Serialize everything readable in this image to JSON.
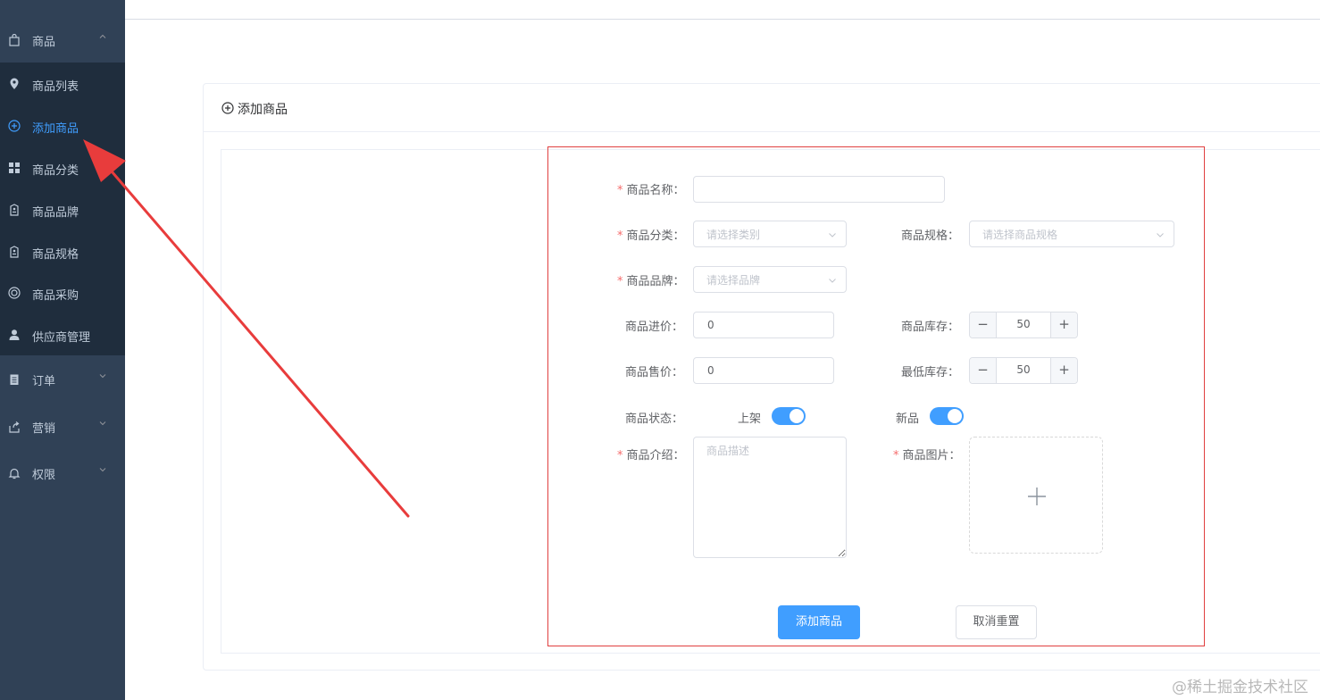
{
  "sidebar": {
    "groups": [
      {
        "label": "商品",
        "icon": "bag-icon",
        "expanded": true
      },
      {
        "label": "订单",
        "icon": "clipboard-icon",
        "expanded": false
      },
      {
        "label": "营销",
        "icon": "share-icon",
        "expanded": false
      },
      {
        "label": "权限",
        "icon": "bell-icon",
        "expanded": false
      }
    ],
    "items": [
      {
        "label": "商品列表",
        "icon": "location-pin-icon"
      },
      {
        "label": "添加商品",
        "icon": "circle-plus-icon",
        "active": true
      },
      {
        "label": "商品分类",
        "icon": "grid-icon"
      },
      {
        "label": "商品品牌",
        "icon": "tag-icon"
      },
      {
        "label": "商品规格",
        "icon": "tag-icon"
      },
      {
        "label": "商品采购",
        "icon": "target-icon"
      },
      {
        "label": "供应商管理",
        "icon": "user-icon"
      }
    ]
  },
  "card": {
    "title": "添加商品",
    "icon": "circle-plus-icon"
  },
  "form": {
    "name": {
      "label": "商品名称：",
      "required": true,
      "value": "",
      "placeholder": ""
    },
    "category": {
      "label": "商品分类：",
      "required": true,
      "placeholder": "请选择类别"
    },
    "spec": {
      "label": "商品规格：",
      "required": false,
      "placeholder": "请选择商品规格"
    },
    "brand": {
      "label": "商品品牌：",
      "required": true,
      "placeholder": "请选择品牌"
    },
    "cost_price": {
      "label": "商品进价：",
      "value": "0"
    },
    "stock": {
      "label": "商品库存：",
      "value": "50",
      "dec": "−",
      "inc": "+"
    },
    "sale_price": {
      "label": "商品售价：",
      "value": "0"
    },
    "min_stock": {
      "label": "最低库存：",
      "value": "50",
      "dec": "−",
      "inc": "+"
    },
    "status": {
      "label": "商品状态：",
      "on_shelf_label": "上架",
      "on_shelf": true,
      "new_label": "新品",
      "is_new": true
    },
    "intro": {
      "label": "商品介绍：",
      "required": true,
      "placeholder": "商品描述",
      "value": ""
    },
    "image": {
      "label": "商品图片：",
      "required": true,
      "icon": "plus-icon"
    },
    "submit_label": "添加商品",
    "reset_label": "取消重置"
  },
  "watermark": "@稀土掘金技术社区",
  "colors": {
    "sidebar_bg": "#304156",
    "submenu_bg": "#1f2d3d",
    "accent": "#409eff",
    "required": "#f56c6c",
    "highlight_box": "#e04040",
    "annotation_arrow": "#e83c3c"
  }
}
